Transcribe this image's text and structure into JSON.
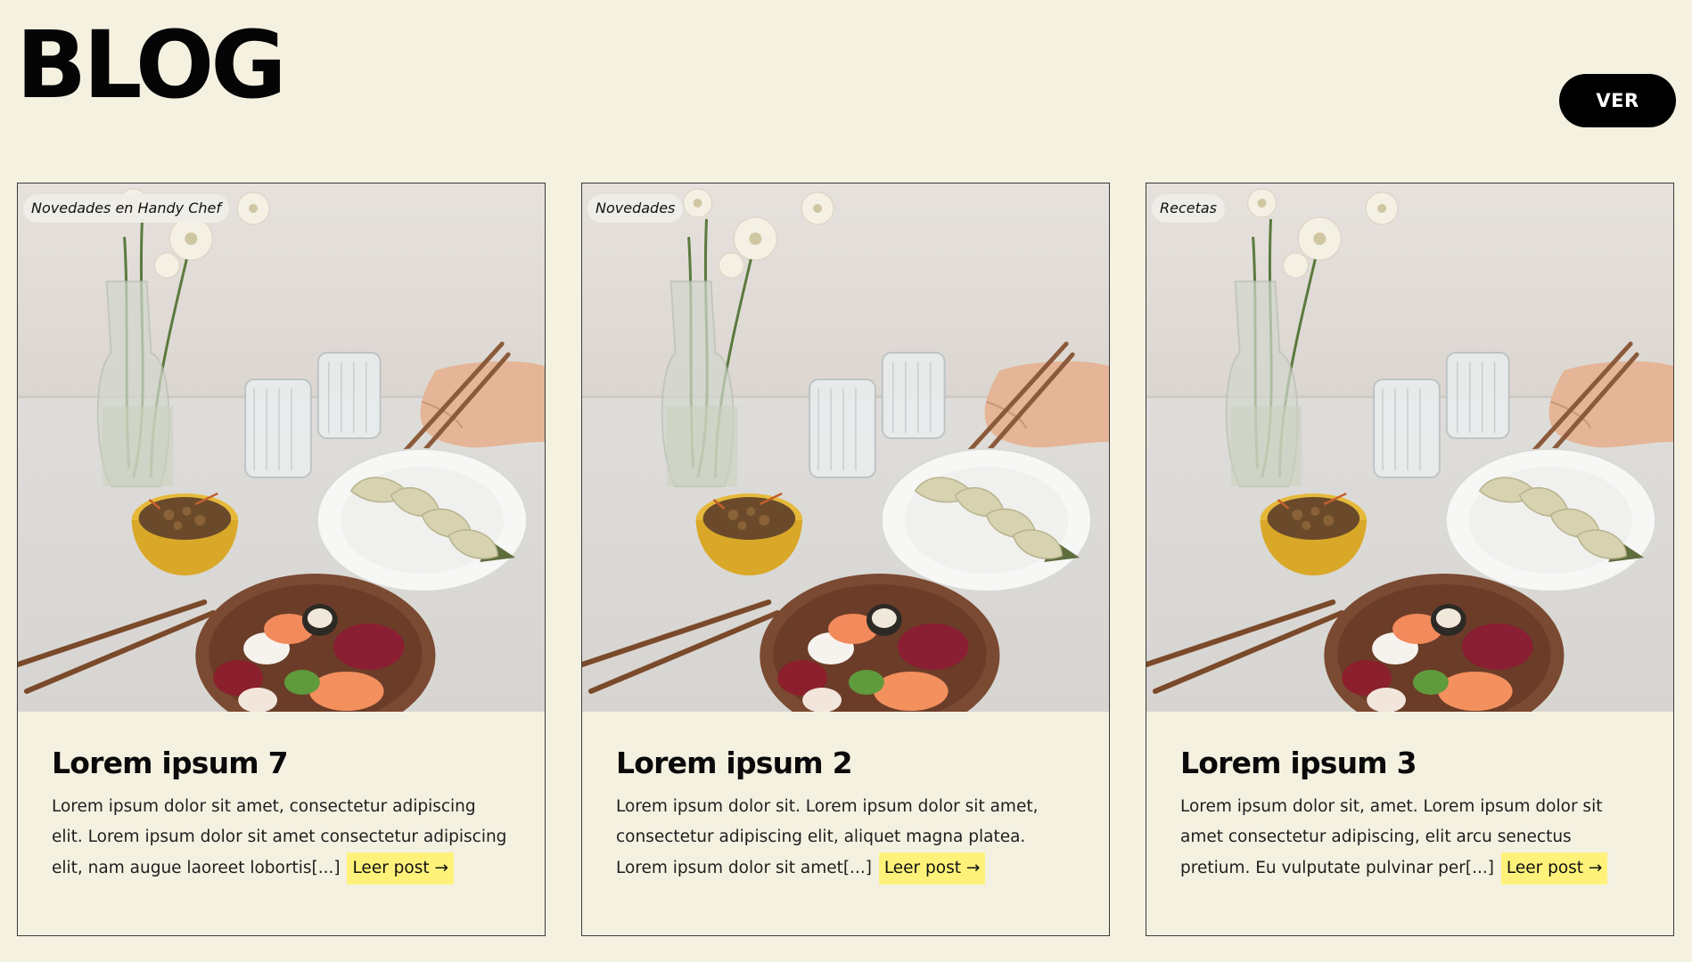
{
  "header": {
    "title": "BLOG",
    "view_button_label": "VER"
  },
  "posts": [
    {
      "category": "Novedades en Handy Chef",
      "title": "Lorem ipsum 7",
      "excerpt": "Lorem ipsum dolor sit amet, consectetur adipiscing elit. Lorem ipsum dolor sit amet consectetur adipiscing elit, nam augue laoreet lobortis[...]",
      "read_more": "Leer post →"
    },
    {
      "category": "Novedades",
      "title": "Lorem ipsum 2",
      "excerpt": "Lorem ipsum dolor sit. Lorem ipsum dolor sit amet, consectetur adipiscing elit, aliquet magna platea. Lorem ipsum dolor sit amet[...]",
      "read_more": "Leer post →"
    },
    {
      "category": "Recetas",
      "title": "Lorem ipsum 3",
      "excerpt": "Lorem ipsum dolor sit, amet. Lorem ipsum dolor sit amet consectetur adipiscing, elit arcu senectus pretium. Eu vulputate pulvinar per[...]",
      "read_more": "Leer post →"
    }
  ]
}
